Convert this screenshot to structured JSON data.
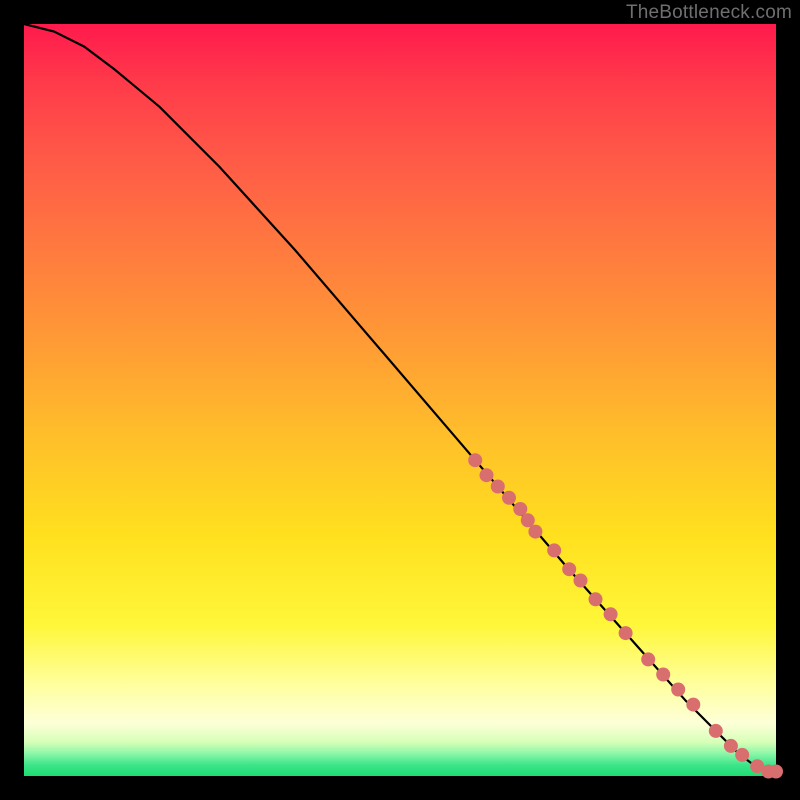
{
  "watermark": "TheBottleneck.com",
  "chart_data": {
    "type": "line",
    "title": "",
    "xlabel": "",
    "ylabel": "",
    "xlim": [
      0,
      100
    ],
    "ylim": [
      0,
      100
    ],
    "grid": false,
    "legend": false,
    "series": [
      {
        "name": "curve",
        "color": "#000000",
        "x": [
          0,
          4,
          8,
          12,
          18,
          26,
          36,
          48,
          60,
          72,
          80,
          88,
          92,
          95,
          97,
          99,
          100
        ],
        "y": [
          100,
          99,
          97,
          94,
          89,
          81,
          70,
          56,
          42,
          28,
          19,
          10,
          6,
          3,
          1.5,
          0.6,
          0.6
        ]
      }
    ],
    "markers": {
      "name": "dots",
      "color": "#d96e6e",
      "radius_px": 7,
      "x": [
        60,
        61.5,
        63,
        64.5,
        66,
        67,
        68,
        70.5,
        72.5,
        74,
        76,
        78,
        80,
        83,
        85,
        87,
        89,
        92,
        94,
        95.5,
        97.5,
        99,
        100
      ],
      "y": [
        42,
        40,
        38.5,
        37,
        35.5,
        34,
        32.5,
        30,
        27.5,
        26,
        23.5,
        21.5,
        19,
        15.5,
        13.5,
        11.5,
        9.5,
        6,
        4,
        2.8,
        1.3,
        0.6,
        0.6
      ]
    }
  }
}
